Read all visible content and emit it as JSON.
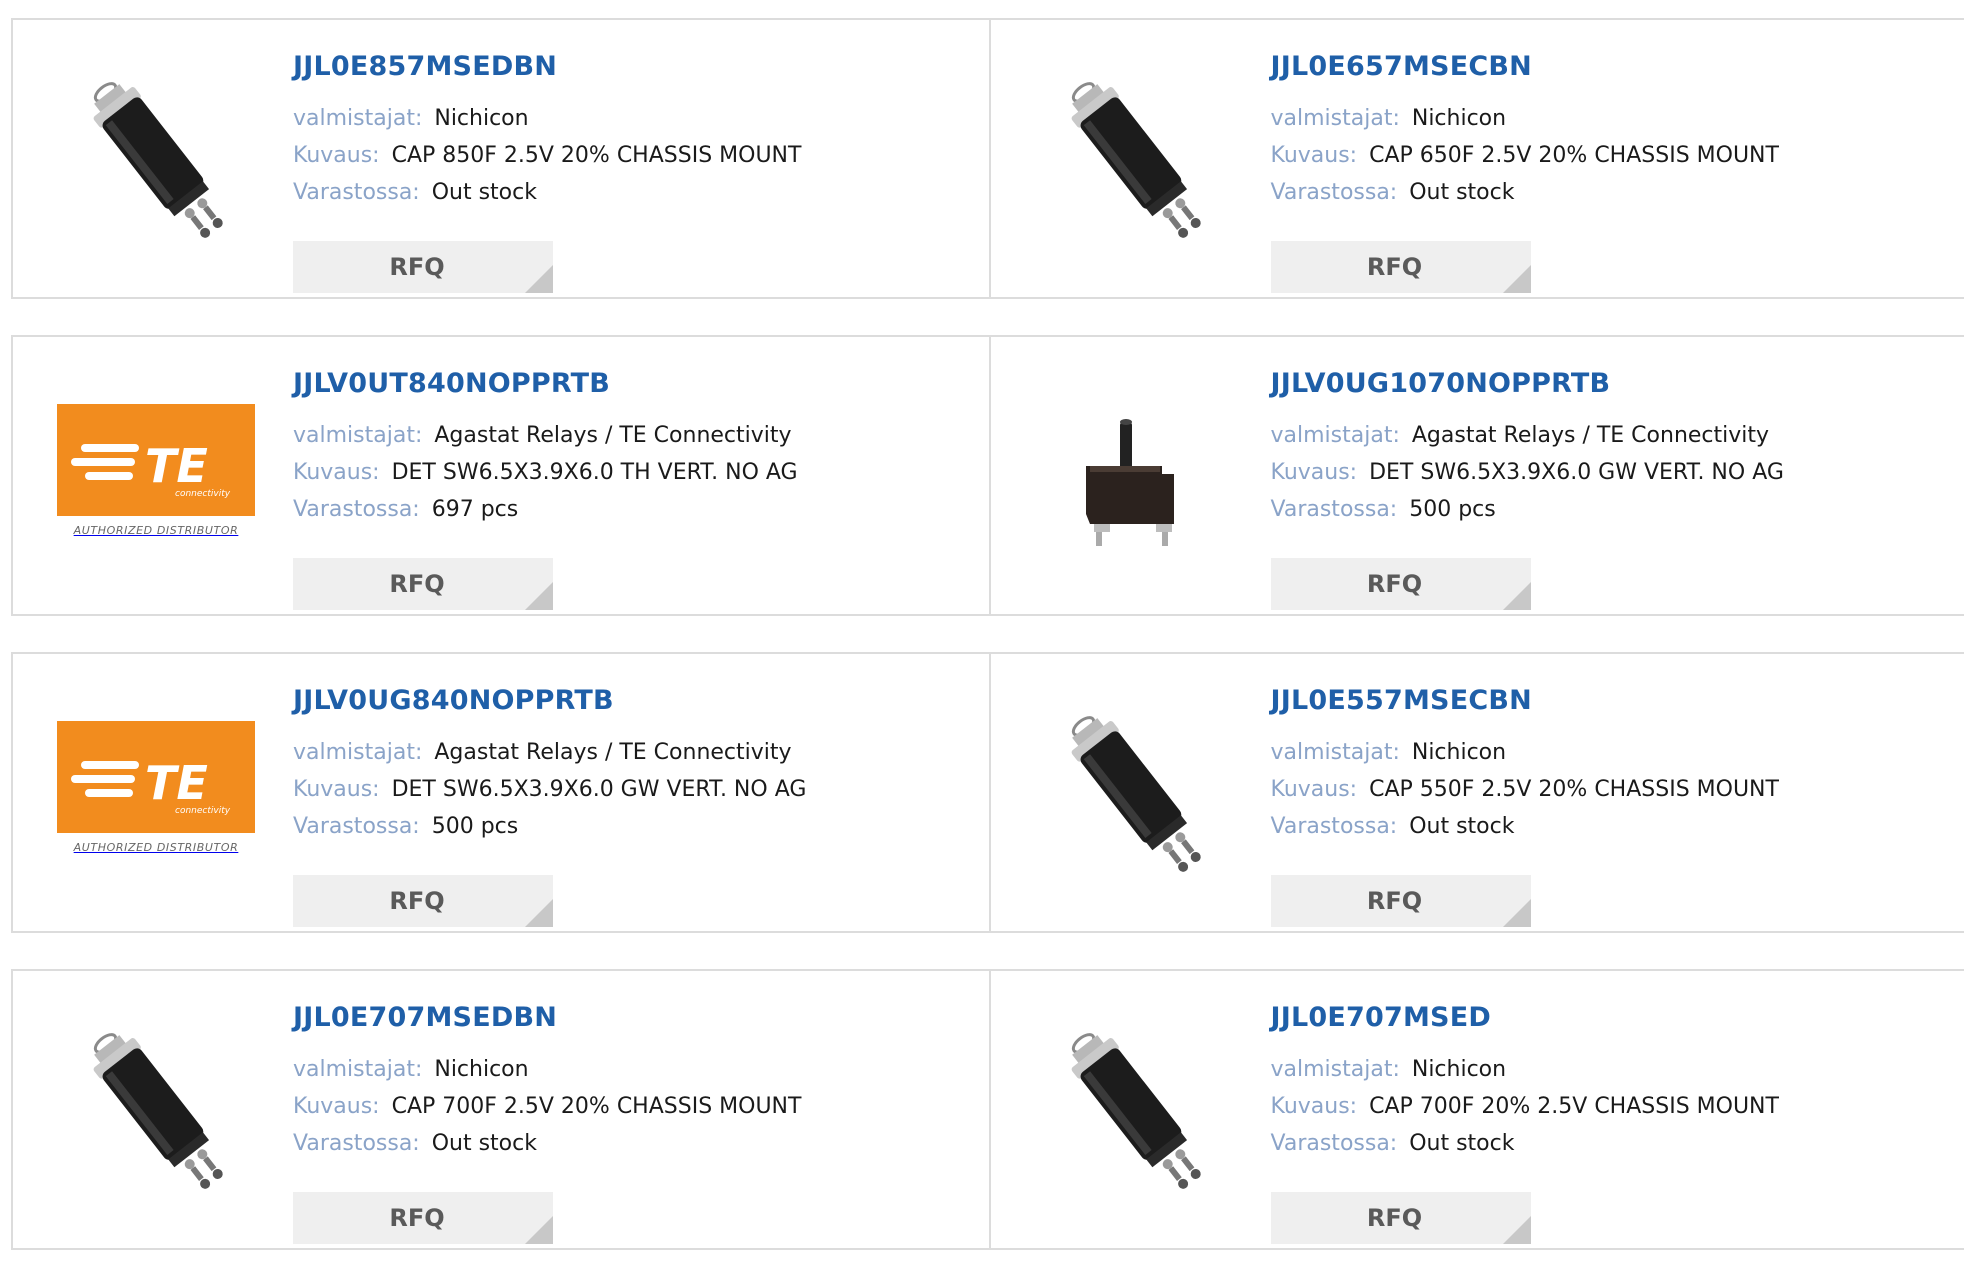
{
  "labels": {
    "manufacturer": "valmistajat:",
    "description": "Kuvaus:",
    "stock": "Varastossa:",
    "rfq": "RFQ"
  },
  "te_logo": {
    "brand": "TE",
    "sub": "connectivity",
    "caption": "AUTHORIZED DISTRIBUTOR"
  },
  "products": [
    {
      "part": "JJL0E857MSEDBN",
      "manufacturer": "Nichicon",
      "description": "CAP 850F 2.5V 20% CHASSIS MOUNT",
      "stock": "Out stock",
      "image": "capacitor-image"
    },
    {
      "part": "JJL0E657MSECBN",
      "manufacturer": "Nichicon",
      "description": "CAP 650F 2.5V 20% CHASSIS MOUNT",
      "stock": "Out stock",
      "image": "capacitor-image"
    },
    {
      "part": "JJLV0UT840NOPPRTB",
      "manufacturer": "Agastat Relays / TE Connectivity",
      "description": "DET SW6.5X3.9X6.0 TH VERT. NO AG",
      "stock": "697 pcs",
      "image": "te-logo"
    },
    {
      "part": "JJLV0UG1070NOPPRTB",
      "manufacturer": "Agastat Relays / TE Connectivity",
      "description": "DET SW6.5X3.9X6.0 GW VERT. NO AG",
      "stock": "500 pcs",
      "image": "switch-image"
    },
    {
      "part": "JJLV0UG840NOPPRTB",
      "manufacturer": "Agastat Relays / TE Connectivity",
      "description": "DET SW6.5X3.9X6.0 GW VERT. NO AG",
      "stock": "500 pcs",
      "image": "te-logo"
    },
    {
      "part": "JJL0E557MSECBN",
      "manufacturer": "Nichicon",
      "description": "CAP 550F 2.5V 20% CHASSIS MOUNT",
      "stock": "Out stock",
      "image": "capacitor-image"
    },
    {
      "part": "JJL0E707MSEDBN",
      "manufacturer": "Nichicon",
      "description": "CAP 700F 2.5V 20% CHASSIS MOUNT",
      "stock": "Out stock",
      "image": "capacitor-image"
    },
    {
      "part": "JJL0E707MSED",
      "manufacturer": "Nichicon",
      "description": "CAP 700F 20% 2.5V CHASSIS MOUNT",
      "stock": "Out stock",
      "image": "capacitor-image"
    }
  ],
  "colors": {
    "link": "#1f5fa8",
    "label": "#8aa3c8",
    "border": "#dcdcdc",
    "te_orange": "#f28c1e"
  }
}
